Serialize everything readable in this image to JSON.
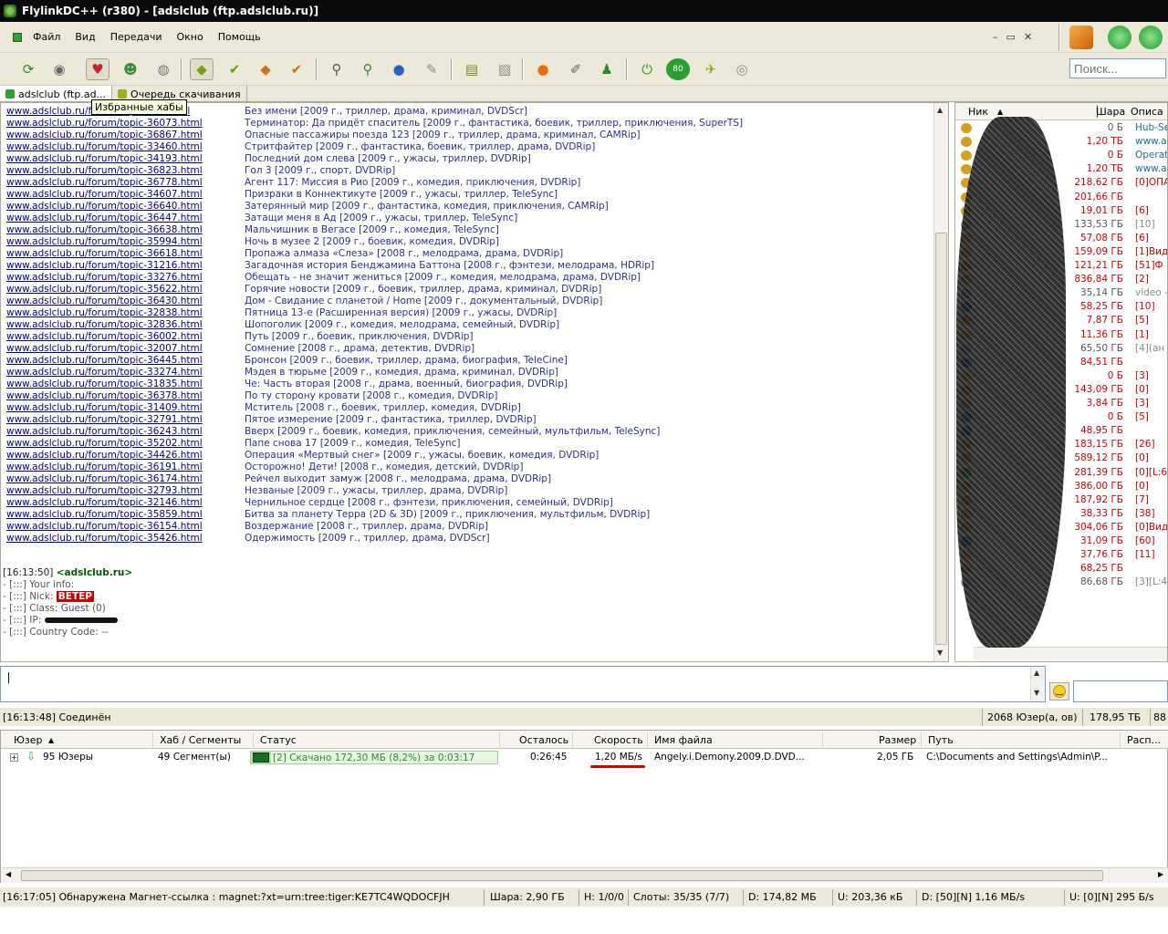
{
  "window": {
    "title": "FlylinkDC++ (r380) - [adslclub (ftp.adslclub.ru)]"
  },
  "menu": [
    "Файл",
    "Вид",
    "Передачи",
    "Окно",
    "Помощь"
  ],
  "window_controls": [
    "–",
    "▭",
    "✕"
  ],
  "toolbar_icons": [
    "reconnect-icon",
    "follow-redirect-icon",
    "favorite-hubs-icon",
    "favorite-users-icon",
    "ignored-users-icon",
    "download-queue-icon",
    "finished-downloads-icon",
    "upload-queue-icon",
    "finished-uploads-icon",
    "search-icon",
    "adl-search-icon",
    "search-spy-icon",
    "notepad-icon",
    "open-file-list-icon",
    "open-own-list-icon",
    "network-stats-icon",
    "settings-icon",
    "user-icon",
    "away-icon",
    "limiter-icon",
    "speed-icon",
    "disk-icon"
  ],
  "search": {
    "placeholder": "Поиск..."
  },
  "tabs": [
    {
      "label": "adslclub (ftp.ad..."
    },
    {
      "label": "Очередь скачивания"
    }
  ],
  "tooltip": "Избранные хабы",
  "chat_links": [
    {
      "url": "www.adslclub.ru/forum/topic-36...html",
      "desc": "Без имени [2009 г., триллер, драма, криминал, DVDScr]"
    },
    {
      "url": "www.adslclub.ru/forum/topic-36073.html",
      "desc": "Терминатор: Да придёт спаситель [2009 г., фантастика, боевик, триллер, приключения, SuperTS]"
    },
    {
      "url": "www.adslclub.ru/forum/topic-36867.html",
      "desc": "Опасные пассажиры поезда 123 [2009 г., триллер, драма, криминал, CAMRip]"
    },
    {
      "url": "www.adslclub.ru/forum/topic-33460.html",
      "desc": "Стритфайтер [2009 г., фантастика, боевик, триллер, драма, DVDRip]"
    },
    {
      "url": "www.adslclub.ru/forum/topic-34193.html",
      "desc": "Последний дом слева [2009 г., ужасы, триллер, DVDRip]"
    },
    {
      "url": "www.adslclub.ru/forum/topic-36823.html",
      "desc": "Гол 3 [2009 г., спорт, DVDRip]"
    },
    {
      "url": "www.adslclub.ru/forum/topic-36778.html",
      "desc": "Агент 117: Миссия в Рио [2009 г., комедия, приключения, DVDRip]"
    },
    {
      "url": "www.adslclub.ru/forum/topic-34607.html",
      "desc": "Призраки в Коннектикуте [2009 г., ужасы, триллер, TeleSync]"
    },
    {
      "url": "www.adslclub.ru/forum/topic-36640.html",
      "desc": "Затерянный мир [2009 г., фантастика, комедия, приключения, CAMRip]"
    },
    {
      "url": "www.adslclub.ru/forum/topic-36447.html",
      "desc": "Затащи меня в Ад [2009 г., ужасы, триллер, TeleSync]"
    },
    {
      "url": "www.adslclub.ru/forum/topic-36638.html",
      "desc": "Мальчишник в Вегасе [2009 г., комедия, TeleSync]"
    },
    {
      "url": "www.adslclub.ru/forum/topic-35994.html",
      "desc": "Ночь в музее 2 [2009 г., боевик, комедия, DVDRip]"
    },
    {
      "url": "www.adslclub.ru/forum/topic-36618.html",
      "desc": "Пропажа алмаза «Слеза» [2008 г., мелодрама, драма, DVDRip]"
    },
    {
      "url": "www.adslclub.ru/forum/topic-31216.html",
      "desc": "Загадочная история Бенджамина Баттона [2008 г., фэнтези, мелодрама, HDRip]"
    },
    {
      "url": "www.adslclub.ru/forum/topic-33276.html",
      "desc": "Обещать - не значит жениться [2009 г., комедия, мелодрама, драма, DVDRip]"
    },
    {
      "url": "www.adslclub.ru/forum/topic-35622.html",
      "desc": "Горячие новости [2009 г., боевик, триллер, драма, криминал, DVDRip]"
    },
    {
      "url": "www.adslclub.ru/forum/topic-36430.html",
      "desc": "Дом - Свидание с планетой / Home [2009 г., документальный, DVDRip]"
    },
    {
      "url": "www.adslclub.ru/forum/topic-32838.html",
      "desc": "Пятница 13-е (Расширенная версия) [2009 г., ужасы, DVDRip]"
    },
    {
      "url": "www.adslclub.ru/forum/topic-32836.html",
      "desc": "Шопоголик [2009 г., комедия, мелодрама, семейный, DVDRip]"
    },
    {
      "url": "www.adslclub.ru/forum/topic-36002.html",
      "desc": "Путь [2009 г., боевик, приключения, DVDRip]"
    },
    {
      "url": "www.adslclub.ru/forum/topic-32007.html",
      "desc": "Сомнение [2008 г., драма, детектив, DVDRip]"
    },
    {
      "url": "www.adslclub.ru/forum/topic-36445.html",
      "desc": "Бронсон [2009 г., боевик, триллер, драма, биография, TeleCine]"
    },
    {
      "url": "www.adslclub.ru/forum/topic-33274.html",
      "desc": "Мэдея в тюрьме [2009 г., комедия, драма, криминал, DVDRip]"
    },
    {
      "url": "www.adslclub.ru/forum/topic-31835.html",
      "desc": "Че: Часть вторая [2008 г., драма, военный, биография, DVDRip]"
    },
    {
      "url": "www.adslclub.ru/forum/topic-36378.html",
      "desc": "По ту сторону кровати [2008 г., комедия, DVDRip]"
    },
    {
      "url": "www.adslclub.ru/forum/topic-31409.html",
      "desc": "Мститель [2008 г., боевик, триллер, комедия, DVDRip]"
    },
    {
      "url": "www.adslclub.ru/forum/topic-32791.html",
      "desc": "Пятое измерение [2009 г., фантастика, триллер, DVDRip]"
    },
    {
      "url": "www.adslclub.ru/forum/topic-36243.html",
      "desc": "Вверх [2009 г., боевик, комедия, приключения, семейный, мультфильм, TeleSync]"
    },
    {
      "url": "www.adslclub.ru/forum/topic-35202.html",
      "desc": "Папе снова 17 [2009 г., комедия, TeleSync]"
    },
    {
      "url": "www.adslclub.ru/forum/topic-34426.html",
      "desc": "Операция «Мертвый снег» [2009 г., ужасы, боевик, комедия, DVDRip]"
    },
    {
      "url": "www.adslclub.ru/forum/topic-36191.html",
      "desc": "Осторожно! Дети! [2008 г., комедия, детский, DVDRip]"
    },
    {
      "url": "www.adslclub.ru/forum/topic-36174.html",
      "desc": "Рейчел выходит замуж [2008 г., мелодрама, драма, DVDRip]"
    },
    {
      "url": "www.adslclub.ru/forum/topic-32793.html",
      "desc": "Незваные [2009 г., ужасы, триллер, драма, DVDRip]"
    },
    {
      "url": "www.adslclub.ru/forum/topic-32146.html",
      "desc": "Чернильное сердце [2008 г., фэнтези, приключения, семейный, DVDRip]"
    },
    {
      "url": "www.adslclub.ru/forum/topic-35859.html",
      "desc": "Битва за планету Терра (2D & 3D) [2009 г., приключения, мультфильм, DVDRip]"
    },
    {
      "url": "www.adslclub.ru/forum/topic-36154.html",
      "desc": "Воздержание [2008 г., триллер, драма, DVDRip]"
    },
    {
      "url": "www.adslclub.ru/forum/topic-35426.html",
      "desc": "Одержимость [2009 г., триллер, драма, DVDScr]"
    }
  ],
  "system_msg": {
    "timestamp": "[16:13:50]",
    "hub": "<adslclub.ru>",
    "line_info": "- [:::] Your info:",
    "line_nick_prefix": "- [:::] Nick: ",
    "nick": "ВЕТЕР",
    "line_class": "- [:::] Class: Guest (0)",
    "line_ip": "- [:::] IP:",
    "line_country": "- [:::] Country Code: --"
  },
  "userlist": {
    "headers": {
      "nick": "Ник",
      "share": "Шара",
      "desc": "Описа"
    },
    "rows": [
      {
        "share": "0 Б",
        "desc": "Hub-Se",
        "color": "#d4a020",
        "g": true,
        "t": true
      },
      {
        "share": "1,20 ТБ",
        "desc": "www.a",
        "color": "#d4a020",
        "g": false,
        "t": true
      },
      {
        "share": "0 Б",
        "desc": "Operat",
        "color": "#d4a020",
        "g": false,
        "t": true
      },
      {
        "share": "1,20 ТБ",
        "desc": "www.a",
        "color": "#d4a020",
        "g": false,
        "t": true
      },
      {
        "share": "218,62 ГБ",
        "desc": "[0]ОПА",
        "color": "#d4a020",
        "g": false,
        "t": false
      },
      {
        "share": "201,66 ГБ",
        "desc": "",
        "color": "#d4a020",
        "g": false,
        "t": false
      },
      {
        "share": "19,01 ГБ",
        "desc": "[6]",
        "color": "#d4a020",
        "g": false,
        "t": false
      },
      {
        "share": "133,53 ГБ",
        "desc": "[10]",
        "color": "#8aa0b0",
        "g": true,
        "t": false
      },
      {
        "share": "57,08 ГБ",
        "desc": "[6]",
        "color": "#d4a020",
        "g": false,
        "t": false
      },
      {
        "share": "159,09 ГБ",
        "desc": "[1]Вид",
        "color": "#d4a020",
        "g": false,
        "t": false
      },
      {
        "share": "121,21 ГБ",
        "desc": "[51]Ф",
        "color": "#d4a020",
        "g": false,
        "t": false
      },
      {
        "share": "836,84 ГБ",
        "desc": "[2]",
        "color": "#d4a020",
        "g": false,
        "t": false
      },
      {
        "share": "35,14 ГБ",
        "desc": "video -",
        "color": "#8aa0b0",
        "g": true,
        "t": false
      },
      {
        "share": "58,25 ГБ",
        "desc": "[10]",
        "color": "#2a6fd0",
        "g": false,
        "t": false
      },
      {
        "share": "7,87 ГБ",
        "desc": "[5]",
        "color": "#d4a020",
        "g": false,
        "t": false
      },
      {
        "share": "11,36 ГБ",
        "desc": "[1]",
        "color": "#d4a020",
        "g": false,
        "t": false
      },
      {
        "share": "65,50 ГБ",
        "desc": "[4](ан",
        "color": "#8aa0b0",
        "g": true,
        "t": false
      },
      {
        "share": "84,51 ГБ",
        "desc": "",
        "color": "#2a6fd0",
        "g": false,
        "t": false
      },
      {
        "share": "0 Б",
        "desc": "[3]",
        "color": "#d4a020",
        "g": false,
        "t": false
      },
      {
        "share": "143,09 ГБ",
        "desc": "[0]",
        "color": "#d4a020",
        "g": false,
        "t": false
      },
      {
        "share": "3,84 ГБ",
        "desc": "[3]",
        "color": "#d4a020",
        "g": false,
        "t": false
      },
      {
        "share": "0 Б",
        "desc": "[5]",
        "color": "#2a6fd0",
        "g": false,
        "t": false
      },
      {
        "share": "48,95 ГБ",
        "desc": "",
        "color": "#2a6fd0",
        "g": false,
        "t": false
      },
      {
        "share": "183,15 ГБ",
        "desc": "[26]",
        "color": "#d4a020",
        "g": false,
        "t": false
      },
      {
        "share": "589,12 ГБ",
        "desc": "[0]",
        "color": "#d4a020",
        "g": false,
        "t": false
      },
      {
        "share": "281,39 ГБ",
        "desc": "[0][L:6",
        "color": "#2fa030",
        "g": false,
        "t": false
      },
      {
        "share": "386,00 ГБ",
        "desc": "[0]",
        "color": "#d4a020",
        "g": false,
        "t": false
      },
      {
        "share": "187,92 ГБ",
        "desc": "[7]",
        "color": "#d4a020",
        "g": false,
        "t": false
      },
      {
        "share": "38,33 ГБ",
        "desc": "[38]",
        "color": "#d4a020",
        "g": false,
        "t": false
      },
      {
        "share": "304,06 ГБ",
        "desc": "[0]Вид",
        "color": "#d4a020",
        "g": false,
        "t": false
      },
      {
        "share": "31,09 ГБ",
        "desc": "[60]",
        "color": "#2a6fd0",
        "g": false,
        "t": false
      },
      {
        "share": "37,76 ГБ",
        "desc": "[11]",
        "color": "#d4a020",
        "g": false,
        "t": false
      },
      {
        "share": "68,25 ГБ",
        "desc": "",
        "color": "#d4a020",
        "g": false,
        "t": false
      },
      {
        "share": "86,68 ГБ",
        "desc": "[3][L:4",
        "color": "#8aa0b0",
        "g": true,
        "t": false
      }
    ]
  },
  "hub_status": {
    "left": "[16:13:48] Соединён",
    "users": "2068 Юзер(а, ов)",
    "share": "178,95 ТБ",
    "extra": "88"
  },
  "transfers": {
    "headers": {
      "user": "Юзер",
      "hub": "Хаб / Сегменты",
      "status": "Статус",
      "remaining": "Осталось",
      "speed": "Скорость",
      "file": "Имя файла",
      "size": "Размер",
      "path": "Путь",
      "dist": "Расп..."
    },
    "row": {
      "user": "95 Юзеры",
      "hub": "49 Сегмент(ы)",
      "status": "[2] Скачано 172,30 МБ (8,2%) за 0:03:17",
      "progress": 0.082,
      "remaining": "0:26:45",
      "speed": "1,20 МБ/s",
      "file": "Angely.i.Demony.2009.D.DVD...",
      "size": "2,05 ГБ",
      "path": "C:\\Documents and Settings\\Admin\\P..."
    }
  },
  "statusbar": {
    "msg": "[16:17:05] Обнаружена Магнет-ссылка : magnet:?xt=urn:tree:tiger:KE7TC4WQDOCFJHQE",
    "share": "Шара: 2,90 ГБ",
    "hubs": "H: 1/0/0",
    "slots": "Слоты: 35/35 (7/7)",
    "down_total": "D: 174,82 МБ",
    "up_total": "U: 203,36 кБ",
    "down_rate": "D: [50][N] 1,16 МБ/s",
    "up_rate": "U: [0][N] 295 Б/s"
  }
}
